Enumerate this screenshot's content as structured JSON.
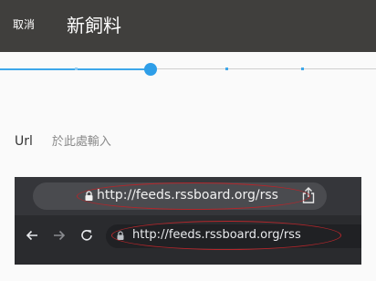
{
  "appbar": {
    "cancel_label": "取消",
    "title": "新飼料",
    "background": "#403f3d"
  },
  "stepper": {
    "steps_total": 6,
    "current_step": 3,
    "accent": "#2e9ee8"
  },
  "form": {
    "url_label": "Url",
    "url_placeholder": "於此處輸入",
    "url_value": ""
  },
  "example_image": {
    "mobile_address": "http://feeds.rssboard.org/rss",
    "desktop_address": "http://feeds.rssboard.org/rss",
    "icons": [
      "lock-icon",
      "share-icon",
      "back-arrow-icon",
      "forward-arrow-icon",
      "reload-icon"
    ],
    "highlight_color": "#b3262b"
  }
}
